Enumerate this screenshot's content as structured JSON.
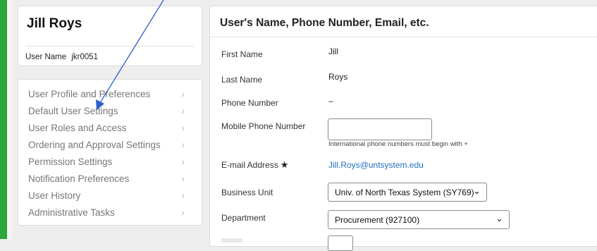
{
  "user": {
    "display_name": "Jill Roys",
    "username_label": "User Name",
    "username": "jkr0051"
  },
  "nav": {
    "items": [
      {
        "label": "User Profile and Preferences"
      },
      {
        "label": "Default User Settings"
      },
      {
        "label": "User Roles and Access"
      },
      {
        "label": "Ordering and Approval Settings"
      },
      {
        "label": "Permission Settings"
      },
      {
        "label": "Notification Preferences"
      },
      {
        "label": "User History"
      },
      {
        "label": "Administrative Tasks"
      }
    ],
    "chevron": "›"
  },
  "main": {
    "title": "User's Name, Phone Number, Email, etc.",
    "first_name_label": "First Name",
    "first_name": "Jill",
    "last_name_label": "Last Name",
    "last_name": "Roys",
    "phone_label": "Phone Number",
    "phone": "–",
    "mobile_label": "Mobile Phone Number",
    "mobile_value": "",
    "mobile_hint": "International phone numbers must begin with +",
    "email_label": "E-mail Address",
    "email_required_marker": "★",
    "email": "Jill.Roys@untsystem.edu",
    "business_unit_label": "Business Unit",
    "business_unit": "Univ. of North Texas System (SY769)",
    "department_label": "Department",
    "department": "Procurement (927100)"
  },
  "colors": {
    "accent_bar": "#2aa63b",
    "link": "#1f6fbf",
    "annotation_arrow": "#2b5fc9"
  },
  "icons": {
    "nav_chevron": "chevron-right-icon",
    "select_caret": "chevron-down-icon",
    "annotation": "arrow-annotation-icon"
  }
}
